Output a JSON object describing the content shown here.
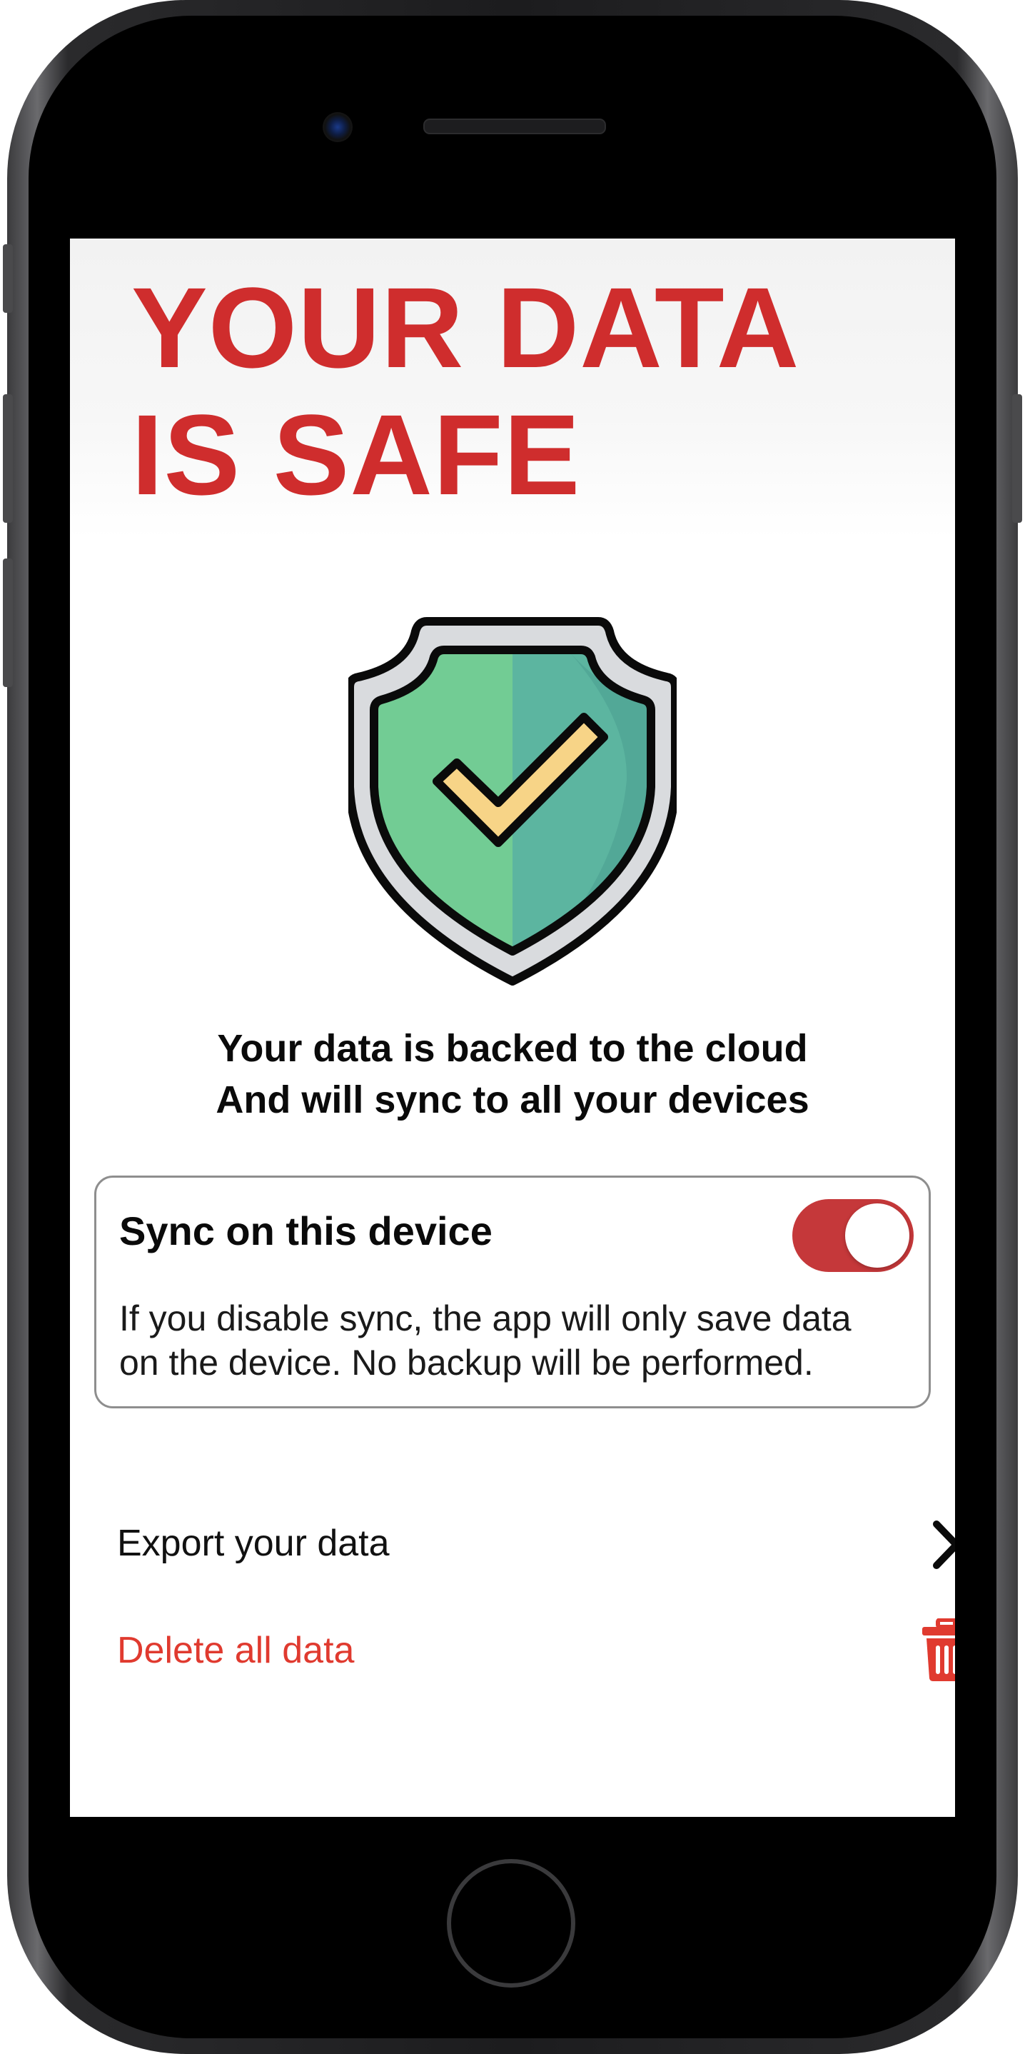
{
  "screen": {
    "title_lines": [
      "YOUR DATA",
      "IS SAFE"
    ],
    "hero_icon": "shield-check-icon",
    "subtitle_lines": [
      "Your data is backed to the cloud",
      "And will sync to all your devices"
    ]
  },
  "sync_card": {
    "title": "Sync on this device",
    "toggle_on": true,
    "description_lines": [
      "If you disable sync, the app will only save data",
      "on the device. No backup will be performed."
    ]
  },
  "actions": {
    "export": {
      "label": "Export your data",
      "icon": "chevron-right-icon"
    },
    "delete": {
      "label": "Delete all data",
      "icon": "trash-icon"
    }
  },
  "colors": {
    "title": "#cf2d2d",
    "toggle_on": "#c5383a",
    "delete": "#e03a2f",
    "shield_left": "#72cc94",
    "shield_right": "#5cb5a0",
    "check": "#f7d487"
  }
}
